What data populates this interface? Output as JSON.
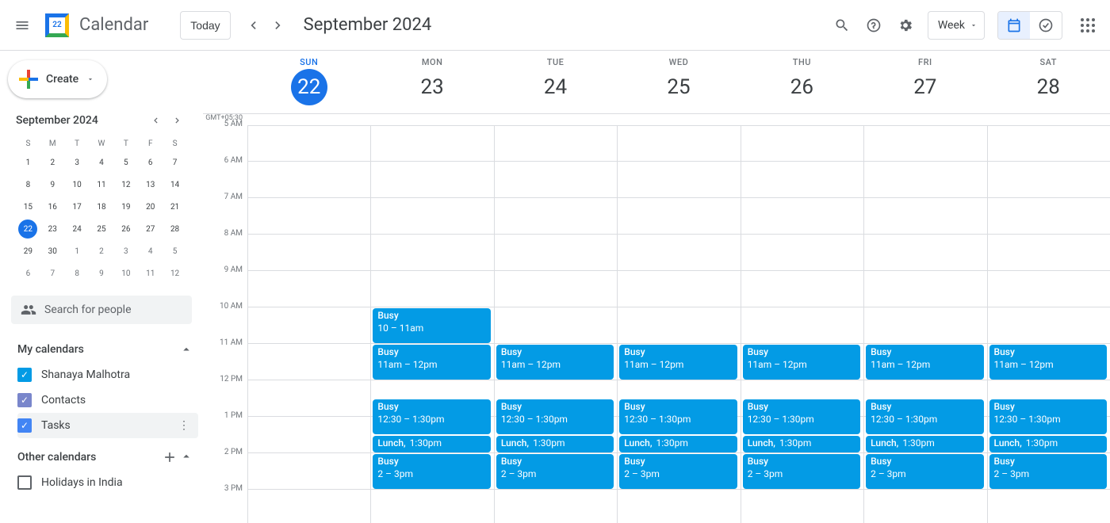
{
  "header": {
    "app_name": "Calendar",
    "logo_day": "22",
    "today_label": "Today",
    "month_label": "September 2024",
    "view_label": "Week"
  },
  "days": [
    {
      "dow": "SUN",
      "num": "22",
      "today": true
    },
    {
      "dow": "MON",
      "num": "23",
      "today": false
    },
    {
      "dow": "TUE",
      "num": "24",
      "today": false
    },
    {
      "dow": "WED",
      "num": "25",
      "today": false
    },
    {
      "dow": "THU",
      "num": "26",
      "today": false
    },
    {
      "dow": "FRI",
      "num": "27",
      "today": false
    },
    {
      "dow": "SAT",
      "num": "28",
      "today": false
    }
  ],
  "timezone": "GMT+05:30",
  "hours": [
    "5 AM",
    "6 AM",
    "7 AM",
    "8 AM",
    "9 AM",
    "10 AM",
    "11 AM",
    "12 PM",
    "1 PM",
    "2 PM",
    "3 PM"
  ],
  "sidebar": {
    "create_label": "Create",
    "mini_title": "September 2024",
    "dows": [
      "S",
      "M",
      "T",
      "W",
      "T",
      "F",
      "S"
    ],
    "weeks": [
      [
        {
          "n": "1"
        },
        {
          "n": "2"
        },
        {
          "n": "3"
        },
        {
          "n": "4"
        },
        {
          "n": "5"
        },
        {
          "n": "6"
        },
        {
          "n": "7"
        }
      ],
      [
        {
          "n": "8"
        },
        {
          "n": "9"
        },
        {
          "n": "10"
        },
        {
          "n": "11"
        },
        {
          "n": "12"
        },
        {
          "n": "13"
        },
        {
          "n": "14"
        }
      ],
      [
        {
          "n": "15"
        },
        {
          "n": "16"
        },
        {
          "n": "17"
        },
        {
          "n": "18"
        },
        {
          "n": "19"
        },
        {
          "n": "20"
        },
        {
          "n": "21"
        }
      ],
      [
        {
          "n": "22",
          "today": true
        },
        {
          "n": "23"
        },
        {
          "n": "24"
        },
        {
          "n": "25"
        },
        {
          "n": "26"
        },
        {
          "n": "27"
        },
        {
          "n": "28"
        }
      ],
      [
        {
          "n": "29"
        },
        {
          "n": "30"
        },
        {
          "n": "1",
          "dim": true
        },
        {
          "n": "2",
          "dim": true
        },
        {
          "n": "3",
          "dim": true
        },
        {
          "n": "4",
          "dim": true
        },
        {
          "n": "5",
          "dim": true
        }
      ],
      [
        {
          "n": "6",
          "dim": true
        },
        {
          "n": "7",
          "dim": true
        },
        {
          "n": "8",
          "dim": true
        },
        {
          "n": "9",
          "dim": true
        },
        {
          "n": "10",
          "dim": true
        },
        {
          "n": "11",
          "dim": true
        },
        {
          "n": "12",
          "dim": true
        }
      ]
    ],
    "search_placeholder": "Search for people",
    "my_calendars_label": "My calendars",
    "my_calendars": [
      {
        "label": "Shanaya Malhotra",
        "color": "#039be5",
        "checked": true
      },
      {
        "label": "Contacts",
        "color": "#7986cb",
        "checked": true
      },
      {
        "label": "Tasks",
        "color": "#4285f4",
        "checked": true,
        "hover": true
      }
    ],
    "other_calendars_label": "Other calendars",
    "other_calendars": [
      {
        "label": "Holidays in India",
        "color": "#5f6368",
        "checked": false
      }
    ]
  },
  "events": {
    "mon_extra": {
      "title": "Busy",
      "time": "10 – 11am",
      "startHour": 10,
      "durHours": 1
    },
    "daily_11": {
      "title": "Busy",
      "time": "11am – 12pm",
      "startHour": 11,
      "durHours": 1
    },
    "daily_1230": {
      "title": "Busy",
      "time": "12:30 – 1:30pm",
      "startHour": 12.5,
      "durHours": 1
    },
    "lunch": {
      "title": "Lunch,",
      "time": "1:30pm",
      "startHour": 13.5,
      "durHours": 0.5
    },
    "daily_14": {
      "title": "Busy",
      "time": "2 – 3pm",
      "startHour": 14,
      "durHours": 1
    }
  }
}
